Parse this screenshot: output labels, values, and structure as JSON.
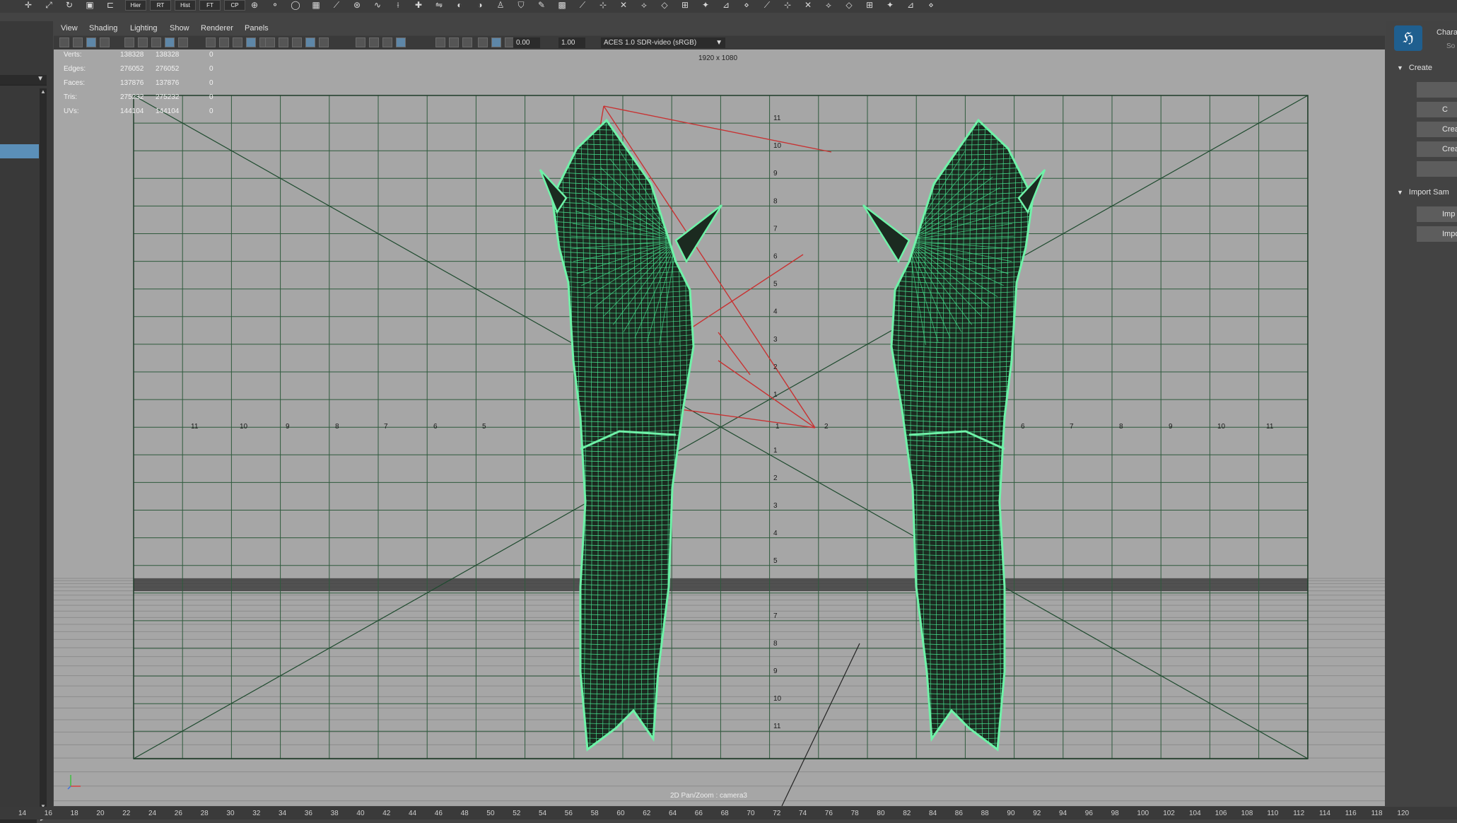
{
  "shelf": {
    "icons": [
      {
        "name": "move-tool-icon",
        "glyph": "✛"
      },
      {
        "name": "transform-tool-icon",
        "glyph": "⤢"
      },
      {
        "name": "rotate-tool-icon",
        "glyph": "↻"
      },
      {
        "name": "scale-tool-icon",
        "glyph": "▣"
      },
      {
        "name": "align-icon",
        "glyph": "⊏"
      },
      {
        "name": "snap-icon",
        "glyph": "⊕"
      },
      {
        "name": "joint-icon",
        "glyph": "⚬"
      },
      {
        "name": "sphere-icon",
        "glyph": "◯"
      },
      {
        "name": "lattice-icon",
        "glyph": "▦"
      },
      {
        "name": "ik-icon",
        "glyph": "⟋"
      },
      {
        "name": "constraint-icon",
        "glyph": "⊛"
      },
      {
        "name": "curve-icon",
        "glyph": "∿"
      },
      {
        "name": "bone-icon",
        "glyph": "⟊"
      },
      {
        "name": "locator-icon",
        "glyph": "✚"
      },
      {
        "name": "mirror-icon",
        "glyph": "⇋"
      },
      {
        "name": "skin-icon",
        "glyph": "◐"
      },
      {
        "name": "weight-icon",
        "glyph": "◑"
      },
      {
        "name": "figure-icon",
        "glyph": "♙"
      },
      {
        "name": "shield-icon",
        "glyph": "⛉"
      },
      {
        "name": "paint-icon",
        "glyph": "✎"
      },
      {
        "name": "grid-tool-icon",
        "glyph": "▩"
      }
    ],
    "text_buttons": [
      "Hier",
      "RT",
      "Hist",
      "FT",
      "CP"
    ]
  },
  "menu": [
    "View",
    "Shading",
    "Lighting",
    "Show",
    "Renderer",
    "Panels"
  ],
  "toolbar": {
    "exposure": "0.00",
    "gamma": "1.00",
    "colorspace": "ACES 1.0 SDR-video (sRGB)"
  },
  "hud": {
    "rows": [
      {
        "label": "Verts:",
        "a": "138328",
        "b": "138328",
        "c": "0"
      },
      {
        "label": "Edges:",
        "a": "276052",
        "b": "276052",
        "c": "0"
      },
      {
        "label": "Faces:",
        "a": "137876",
        "b": "137876",
        "c": "0"
      },
      {
        "label": "Tris:",
        "a": "275232",
        "b": "275232",
        "c": "0"
      },
      {
        "label": "UVs:",
        "a": "144104",
        "b": "144104",
        "c": "0"
      }
    ]
  },
  "viewport": {
    "resolution": "1920 x 1080",
    "camera": "2D Pan/Zoom : camera3",
    "grid_labels_x": [
      "11",
      "10",
      "9",
      "8",
      "7",
      "6",
      "5",
      "2",
      "1",
      "1",
      "2",
      "5",
      "6",
      "7",
      "8",
      "9",
      "10",
      "11"
    ],
    "grid_labels_y_up": [
      "11",
      "10",
      "9",
      "8",
      "7",
      "6",
      "5",
      "4",
      "3",
      "2",
      "1"
    ],
    "grid_labels_y_down": [
      "1",
      "2",
      "3",
      "4",
      "5",
      "7",
      "8",
      "9",
      "10",
      "11"
    ],
    "wire_color": "#47e38f",
    "background_color": "#a6a6a6"
  },
  "right_panel": {
    "title": "Chara",
    "subtitle": "So",
    "sections": [
      {
        "label": "Create",
        "buttons": [
          "",
          "C",
          "Crea",
          "Creat",
          ""
        ]
      },
      {
        "label": "Import Sam",
        "buttons": [
          "Imp",
          "Impo"
        ]
      }
    ]
  },
  "timeslider": {
    "ticks": [
      "14",
      "16",
      "18",
      "20",
      "22",
      "24",
      "26",
      "28",
      "30",
      "32",
      "34",
      "36",
      "38",
      "40",
      "42",
      "44",
      "46",
      "48",
      "50",
      "52",
      "54",
      "56",
      "58",
      "60",
      "62",
      "64",
      "66",
      "68",
      "70",
      "72",
      "74",
      "76",
      "78",
      "80",
      "82",
      "84",
      "86",
      "88",
      "90",
      "92",
      "94",
      "96",
      "98",
      "100",
      "102",
      "104",
      "106",
      "108",
      "110",
      "112",
      "114",
      "116",
      "118",
      "120"
    ]
  }
}
